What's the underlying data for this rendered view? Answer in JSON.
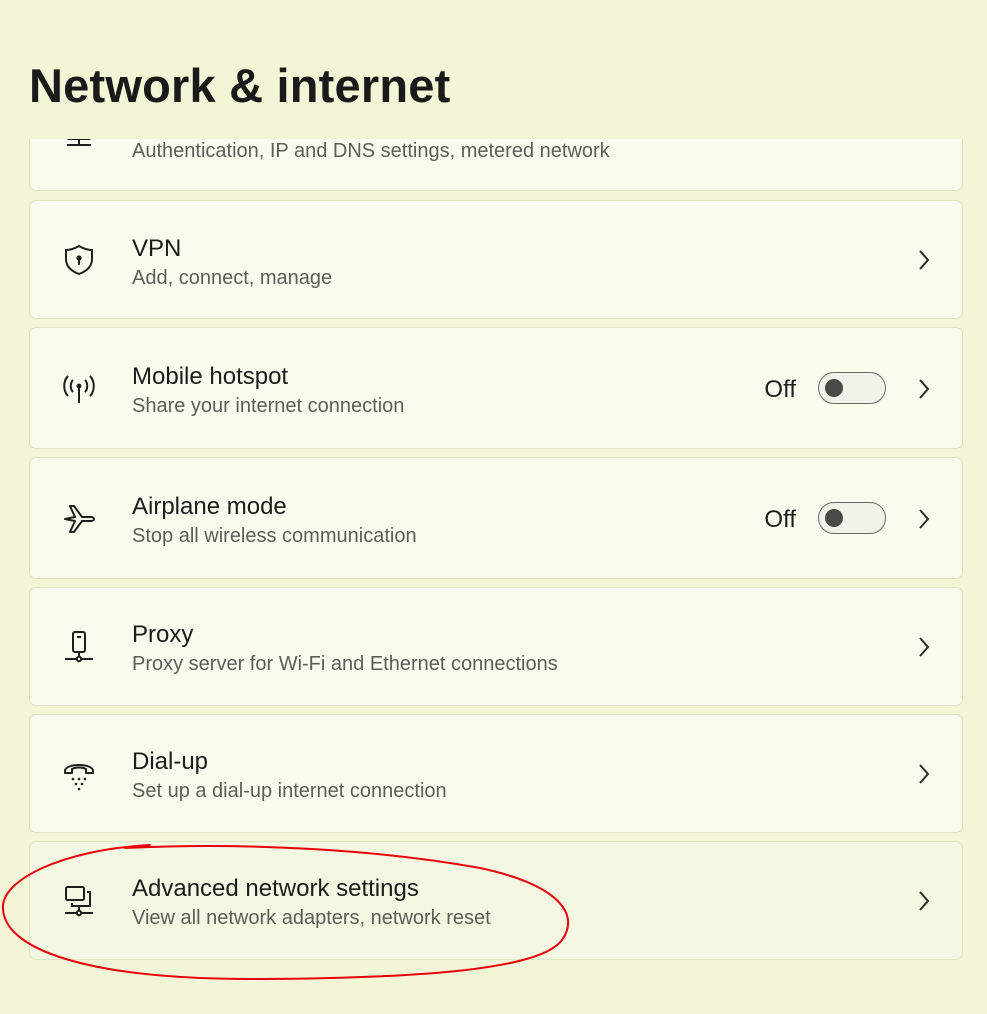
{
  "page": {
    "title": "Network & internet"
  },
  "items": [
    {
      "key": "advanced-properties",
      "title": "",
      "subtitle": "Authentication, IP and DNS settings, metered network",
      "icon": "ethernet-icon"
    },
    {
      "key": "vpn",
      "title": "VPN",
      "subtitle": "Add, connect, manage",
      "icon": "shield-icon"
    },
    {
      "key": "mobile-hotspot",
      "title": "Mobile hotspot",
      "subtitle": "Share your internet connection",
      "icon": "hotspot-icon",
      "state": "Off",
      "toggle_on": false
    },
    {
      "key": "airplane-mode",
      "title": "Airplane mode",
      "subtitle": "Stop all wireless communication",
      "icon": "airplane-icon",
      "state": "Off",
      "toggle_on": false
    },
    {
      "key": "proxy",
      "title": "Proxy",
      "subtitle": "Proxy server for Wi-Fi and Ethernet connections",
      "icon": "proxy-icon"
    },
    {
      "key": "dial-up",
      "title": "Dial-up",
      "subtitle": "Set up a dial-up internet connection",
      "icon": "dialup-phone-icon"
    },
    {
      "key": "advanced-network-settings",
      "title": "Advanced network settings",
      "subtitle": "View all network adapters, network reset",
      "icon": "network-computer-icon"
    }
  ],
  "colors": {
    "background": "#f2f6d6",
    "card": "#fafbef",
    "card_border": "#dfe5c2",
    "annotation": "#e8000b"
  }
}
